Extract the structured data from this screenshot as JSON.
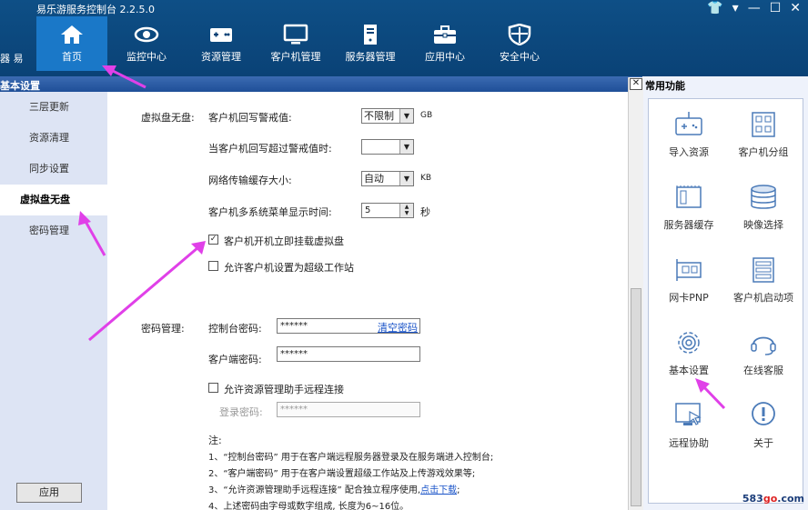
{
  "app": {
    "title": "易乐游服务控制台 2.2.5.0"
  },
  "window_controls": {
    "skin": "👕",
    "menu": "▾",
    "min": "—",
    "max": "☐",
    "close": "✕"
  },
  "nav_cut": "器  易",
  "nav": [
    {
      "label": "首页",
      "icon": "home-icon"
    },
    {
      "label": "监控中心",
      "icon": "eye-icon"
    },
    {
      "label": "资源管理",
      "icon": "resource-icon"
    },
    {
      "label": "客户机管理",
      "icon": "monitor-icon"
    },
    {
      "label": "服务器管理",
      "icon": "server-icon"
    },
    {
      "label": "应用中心",
      "icon": "toolbox-icon"
    },
    {
      "label": "安全中心",
      "icon": "shield-icon"
    }
  ],
  "left_panel": {
    "title": "基本设置",
    "items": [
      "三层更新",
      "资源清理",
      "同步设置",
      "虚拟盘无盘",
      "密码管理"
    ],
    "active_index": 3,
    "apply_label": "应用"
  },
  "vdisk": {
    "section_label": "虚拟盘无盘:",
    "writeback_label": "客户机回写警戒值:",
    "writeback_value": "不限制",
    "writeback_unit": "GB",
    "exceed_label": "当客户机回写超过警戒值时:",
    "exceed_value": "",
    "netcache_label": "网络传输缓存大小:",
    "netcache_value": "自动",
    "netcache_unit": "KB",
    "menu_time_label": "客户机多系统菜单显示时间:",
    "menu_time_value": "5",
    "menu_time_unit": "秒",
    "mount_label": "客户机开机立即挂载虚拟盘",
    "mount_checked": true,
    "superws_label": "允许客户机设置为超级工作站",
    "superws_checked": false
  },
  "password": {
    "section_label": "密码管理:",
    "console_label": "控制台密码:",
    "console_value": "******",
    "clear_link": "清空密码",
    "client_label": "客户端密码:",
    "client_value": "******",
    "remote_label": "允许资源管理助手远程连接",
    "remote_checked": false,
    "login_label": "登录密码:",
    "login_value": "******"
  },
  "notes": {
    "title": "注:",
    "line1": "1、“控制台密码” 用于在客户端远程服务器登录及在服务端进入控制台;",
    "line2": "2、“客户端密码” 用于在客户端设置超级工作站及上传游戏效果等;",
    "line3_pre": "3、“允许资源管理助手远程连接” 配合独立程序使用,",
    "line3_link": "点击下载",
    "line3_post": ";",
    "line4": "4、上述密码由字母或数字组成, 长度为6~16位。"
  },
  "right_panel": {
    "title": "常用功能",
    "items": [
      {
        "label": "导入资源",
        "icon": "import-icon"
      },
      {
        "label": "客户机分组",
        "icon": "group-icon"
      },
      {
        "label": "服务器缓存",
        "icon": "memory-icon"
      },
      {
        "label": "映像选择",
        "icon": "disk-stack-icon"
      },
      {
        "label": "网卡PNP",
        "icon": "network-card-icon"
      },
      {
        "label": "客户机启动项",
        "icon": "boot-list-icon"
      },
      {
        "label": "基本设置",
        "icon": "settings-gear-icon"
      },
      {
        "label": "在线客服",
        "icon": "headset-icon"
      },
      {
        "label": "远程协助",
        "icon": "remote-icon"
      },
      {
        "label": "关于",
        "icon": "info-icon"
      }
    ]
  },
  "watermark": {
    "pre": "583",
    "mid": "go",
    "post": ".com"
  },
  "colors": {
    "topbar": "#0a4276",
    "nav_active": "#1a78c8",
    "left_bg": "#dde4f4",
    "annotation_arrow": "#e040e8"
  }
}
